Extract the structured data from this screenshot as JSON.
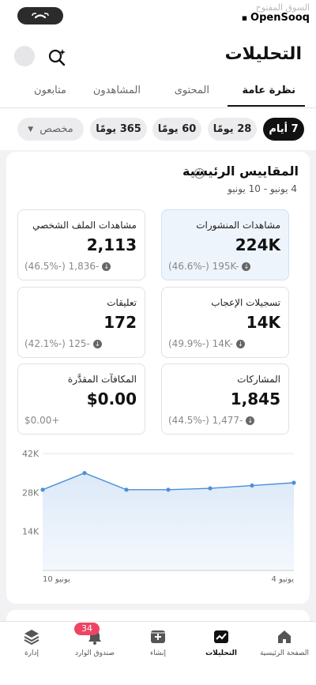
{
  "status": {
    "call_icon": "phone-icon"
  },
  "brand": {
    "arabic": "السوق المفتوح",
    "english": "OpenSooq"
  },
  "header": {
    "title": "التحليلات",
    "search_icon": "search-sparkle-icon"
  },
  "tabs": [
    {
      "label": "نظرة عامة",
      "active": true
    },
    {
      "label": "المحتوى",
      "active": false
    },
    {
      "label": "المشاهدون",
      "active": false
    },
    {
      "label": "متابعون",
      "active": false
    }
  ],
  "ranges": [
    {
      "label": "7 أيام",
      "active": true
    },
    {
      "label": "28 يومًا",
      "active": false
    },
    {
      "label": "60 يومًا",
      "active": false
    },
    {
      "label": "365 يومًا",
      "active": false
    },
    {
      "label": "مخصص",
      "active": false
    }
  ],
  "section": {
    "title": "المقاييس الرئيسية",
    "date_range": "4 يونيو - 10 يونيو"
  },
  "metrics": [
    {
      "label": "مشاهدات المنشورات",
      "value": "224K",
      "delta": "(46.6%-) 195K-",
      "selected": true
    },
    {
      "label": "مشاهدات الملف الشخصي",
      "value": "2,113",
      "delta": "(46.5%-) 1,836-",
      "selected": false
    },
    {
      "label": "تسجيلات الإعجاب",
      "value": "14K",
      "delta": "(49.9%-) 14K-",
      "selected": false
    },
    {
      "label": "تعليقات",
      "value": "172",
      "delta": "(42.1%-) 125-",
      "selected": false
    },
    {
      "label": "المشاركات",
      "value": "1,845",
      "delta": "(44.5%-) 1,477-",
      "selected": false
    },
    {
      "label": "المكافآت المقدَّرة",
      "value": "$0.00",
      "delta": "$0.00+",
      "selected": false
    }
  ],
  "chart_data": {
    "type": "area",
    "x": [
      "4 يونيو",
      "5 يونيو",
      "6 يونيو",
      "7 يونيو",
      "8 يونيو",
      "9 يونيو",
      "10 يونيو"
    ],
    "x_direction": "right-to-left",
    "tick_labels_x": [
      "4 يونيو",
      "10 يونيو"
    ],
    "y_ticks": [
      "42K",
      "28K",
      "14K"
    ],
    "ylim": [
      0,
      42000
    ],
    "series": [
      {
        "values": [
          31500,
          30500,
          29500,
          29000,
          29000,
          35000,
          29000
        ]
      }
    ],
    "color": "#4a90d9",
    "fill_color": "#dce9f8",
    "grid": true
  },
  "nav": [
    {
      "label": "الصفحة الرئيسية",
      "icon": "home-icon",
      "active": false
    },
    {
      "label": "التحليلات",
      "icon": "analytics-icon",
      "active": true
    },
    {
      "label": "إنشاء",
      "icon": "create-icon",
      "active": false
    },
    {
      "label": "صندوق الوارد",
      "icon": "bell-icon",
      "active": false,
      "badge": "34"
    },
    {
      "label": "إدارة",
      "icon": "layers-icon",
      "active": false
    }
  ]
}
